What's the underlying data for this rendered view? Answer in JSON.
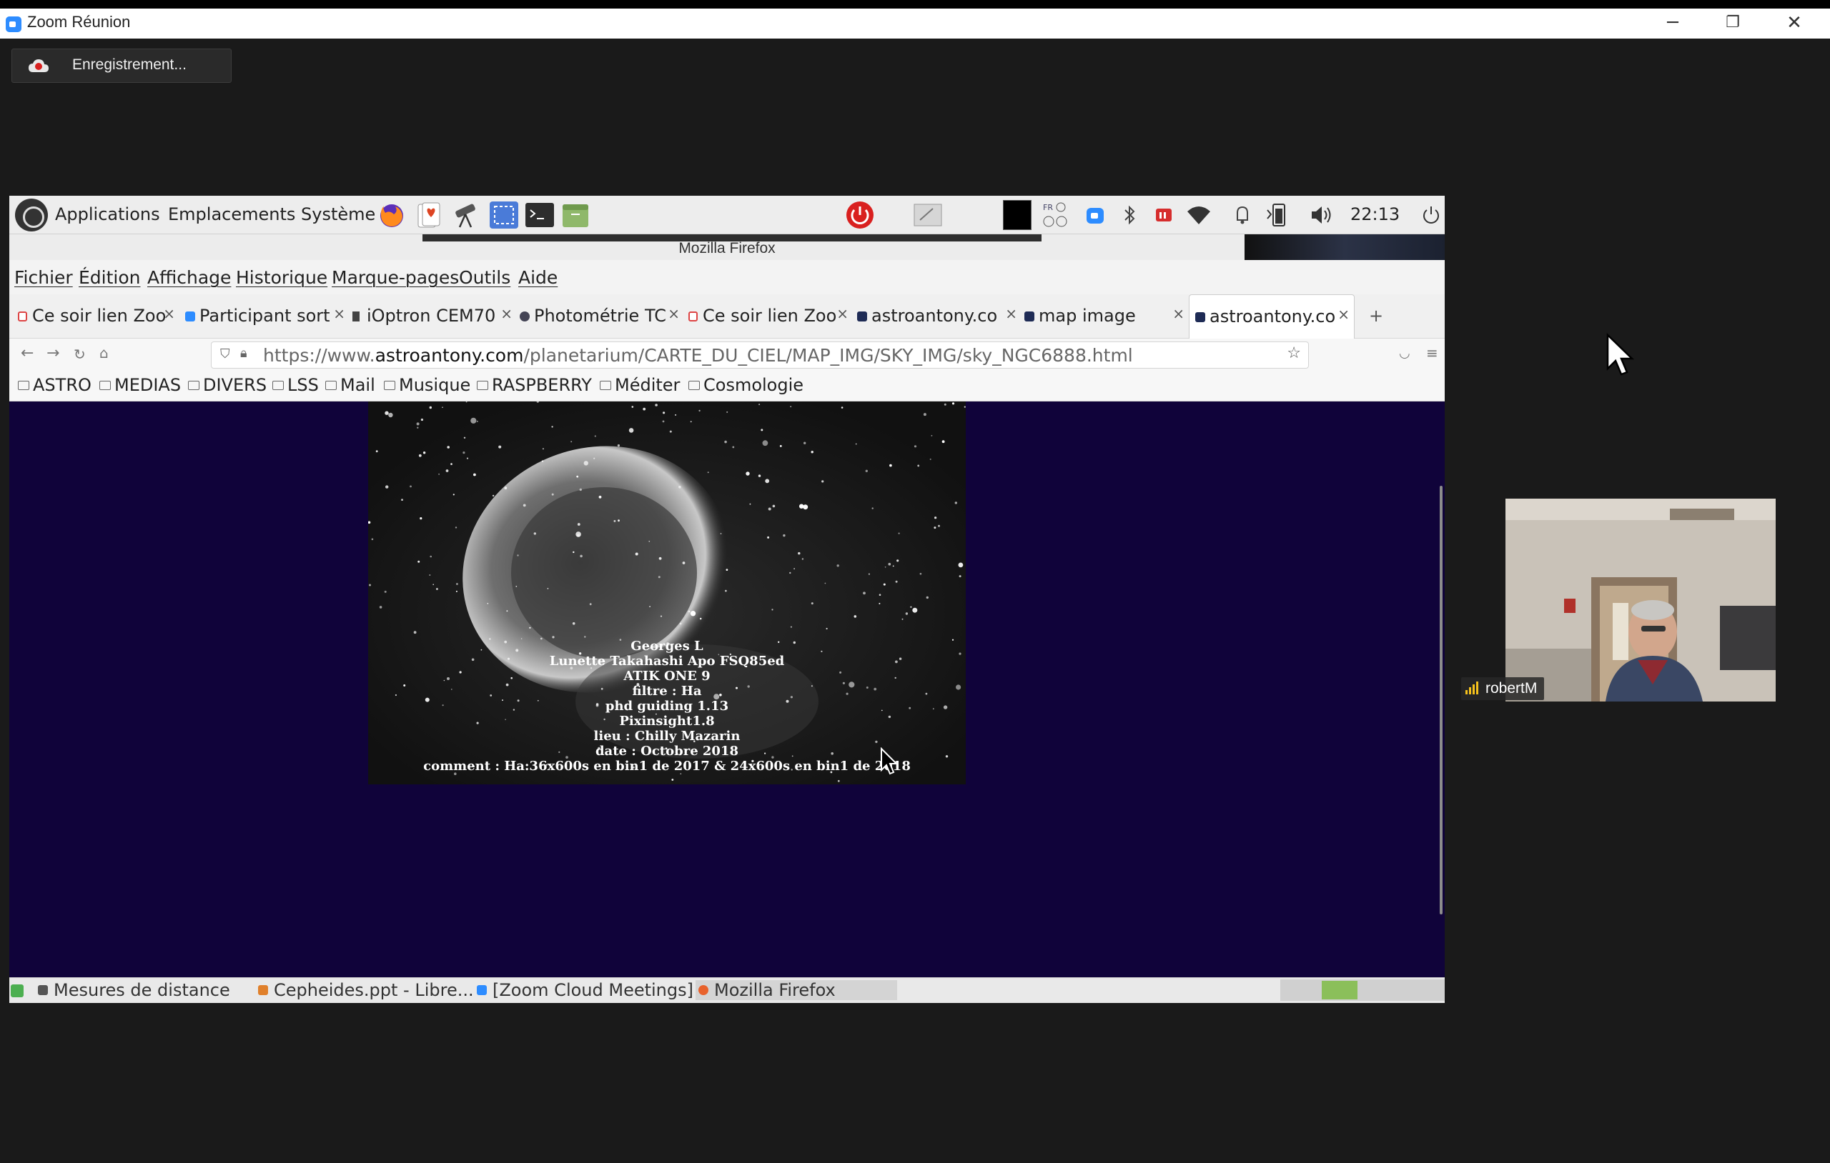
{
  "zoom": {
    "window_title": "Zoom Réunion",
    "recording_label": "Enregistrement...",
    "participant_name": "robertM",
    "window_buttons": {
      "minimize": "─",
      "maximize": "❐",
      "close": "✕"
    }
  },
  "panel": {
    "menus": [
      "Applications",
      "Emplacements",
      "Système"
    ],
    "clock": "22:13",
    "keyboard_layout": "FR"
  },
  "firefox": {
    "window_title": "Mozilla Firefox",
    "menu": [
      "Fichier",
      "Édition",
      "Affichage",
      "Historique",
      "Marque-pages",
      "Outils",
      "Aide"
    ],
    "tabs": [
      {
        "label": "Ce soir lien Zoo",
        "icon": "gmail-icon"
      },
      {
        "label": "Participant sort",
        "icon": "zoom-icon"
      },
      {
        "label": "iOptron CEM70",
        "icon": "ioptron-icon"
      },
      {
        "label": "Photométrie TC",
        "icon": "globe-icon"
      },
      {
        "label": "Ce soir lien Zoo",
        "icon": "gmail-icon"
      },
      {
        "label": "astroantony.co",
        "icon": "astro-icon"
      },
      {
        "label": "map image",
        "icon": "astro-icon"
      },
      {
        "label": "astroantony.co",
        "icon": "astro-icon",
        "active": true
      }
    ],
    "new_tab": "+",
    "url_prefix": "https://www.",
    "url_domain": "astroantony.com",
    "url_path": "/planetarium/CARTE_DU_CIEL/MAP_IMG/SKY_IMG/sky_NGC6888.html",
    "bookmarks": [
      "ASTRO",
      "MEDIAS",
      "DIVERS",
      "LSS",
      "Mail",
      "Musique",
      "RASPBERRY",
      "Méditer",
      "Cosmologie"
    ]
  },
  "page": {
    "caption_lines": [
      "Georges L",
      "Lunette Takahashi Apo FSQ85ed",
      "ATIK ONE 9",
      "filtre : Ha",
      "phd guiding 1.13",
      "Pixinsight1.8",
      "lieu : Chilly Mazarin",
      "date : Octobre 2018",
      "comment : Ha:36x600s en bin1 de 2017 & 24x600s en bin1 de 2018"
    ]
  },
  "taskbar": {
    "items": [
      "Mesures de distance",
      "Cepheides.ppt - Libre...",
      "[Zoom Cloud Meetings]",
      "Mozilla Firefox"
    ]
  },
  "colors": {
    "page_bg": "#10033a",
    "zoom_blue": "#2d8cff",
    "power_red": "#d9201f"
  }
}
